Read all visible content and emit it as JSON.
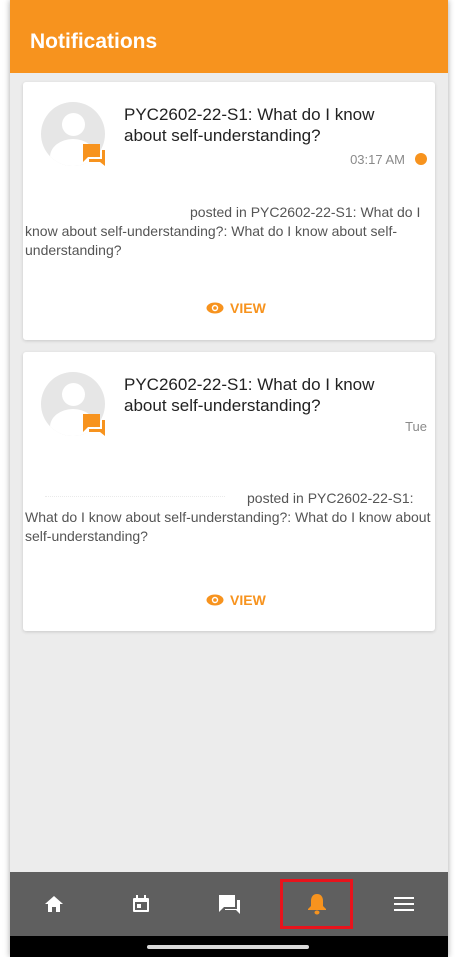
{
  "app": {
    "header_title": "Notifications",
    "accent_color": "#f7931e",
    "unread_color": "#f7931e",
    "active_highlight_color": "#e8141c"
  },
  "notifications": [
    {
      "title": "PYC2602-22-S1: What do I know about self-understanding?",
      "time": "03:17 AM",
      "unread": true,
      "body": "posted in PYC2602-22-S1: What do I know about self-understanding?: What do I know about self-understanding?",
      "action_label": "VIEW",
      "icons": {
        "avatar": "user-avatar-icon",
        "badge": "forum-chat-icon",
        "action": "eye-icon"
      }
    },
    {
      "title": "PYC2602-22-S1: What do I know about self-understanding?",
      "time": "Tue",
      "unread": false,
      "body": "posted in PYC2602-22-S1: What do I know about self-understanding?: What do I know about self-understanding?",
      "action_label": "VIEW",
      "icons": {
        "avatar": "user-avatar-icon",
        "badge": "forum-chat-icon",
        "action": "eye-icon"
      }
    }
  ],
  "bottom_nav": {
    "active": "notifications",
    "items": [
      {
        "id": "home",
        "icon": "home-icon"
      },
      {
        "id": "calendar",
        "icon": "calendar-icon"
      },
      {
        "id": "messages",
        "icon": "chat-icon"
      },
      {
        "id": "notifications",
        "icon": "bell-icon"
      },
      {
        "id": "menu",
        "icon": "menu-icon"
      }
    ]
  }
}
